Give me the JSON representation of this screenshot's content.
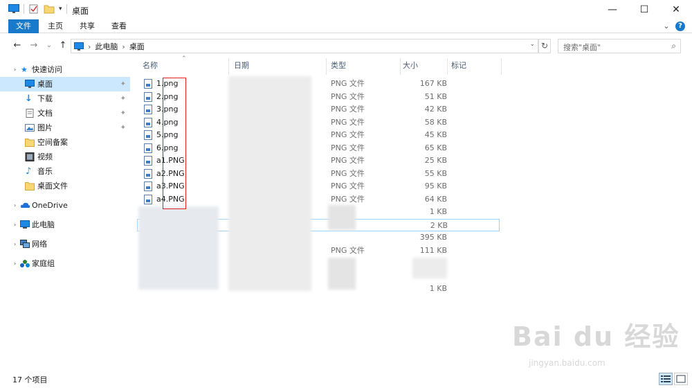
{
  "window": {
    "title": "桌面",
    "controls": {
      "minimize": "—",
      "maximize": "☐",
      "close": "✕"
    }
  },
  "ribbon": {
    "tabs": [
      "文件",
      "主页",
      "共享",
      "查看"
    ],
    "help": "?",
    "expand": "⌄"
  },
  "nav": {
    "back": "←",
    "forward": "→",
    "recent": "⌄",
    "up": "↑",
    "breadcrumb": [
      "此电脑",
      "桌面"
    ],
    "search_placeholder": "搜索\"桌面\""
  },
  "sidebar": {
    "items": [
      {
        "label": "快速访问",
        "icon": "star-icon",
        "pinned": false
      },
      {
        "label": "桌面",
        "icon": "desktop-icon",
        "pinned": true,
        "selected": true
      },
      {
        "label": "下载",
        "icon": "download-icon",
        "pinned": true
      },
      {
        "label": "文档",
        "icon": "document-icon",
        "pinned": true
      },
      {
        "label": "图片",
        "icon": "picture-icon",
        "pinned": true
      },
      {
        "label": "空间备案",
        "icon": "folder-icon",
        "pinned": false
      },
      {
        "label": "视频",
        "icon": "video-icon",
        "pinned": false
      },
      {
        "label": "音乐",
        "icon": "music-icon",
        "pinned": false
      },
      {
        "label": "桌面文件",
        "icon": "folder-icon",
        "pinned": false
      },
      {
        "label": "OneDrive",
        "icon": "cloud-icon",
        "pinned": false
      },
      {
        "label": "此电脑",
        "icon": "computer-icon",
        "pinned": false
      },
      {
        "label": "网络",
        "icon": "network-icon",
        "pinned": false
      },
      {
        "label": "家庭组",
        "icon": "homegroup-icon",
        "pinned": false
      }
    ],
    "pin_glyph": "📌"
  },
  "columns": {
    "name": "名称",
    "date": "日期",
    "type": "类型",
    "size": "大小",
    "tags": "标记"
  },
  "files": [
    {
      "name": "1.png",
      "type": "PNG 文件",
      "size": "167 KB"
    },
    {
      "name": "2.png",
      "type": "PNG 文件",
      "size": "51 KB"
    },
    {
      "name": "3.png",
      "type": "PNG 文件",
      "size": "42 KB"
    },
    {
      "name": "4.png",
      "type": "PNG 文件",
      "size": "58 KB"
    },
    {
      "name": "5.png",
      "type": "PNG 文件",
      "size": "45 KB"
    },
    {
      "name": "6.png",
      "type": "PNG 文件",
      "size": "65 KB"
    },
    {
      "name": "a1.PNG",
      "type": "PNG 文件",
      "size": "25 KB"
    },
    {
      "name": "a2.PNG",
      "type": "PNG 文件",
      "size": "55 KB"
    },
    {
      "name": "a3.PNG",
      "type": "PNG 文件",
      "size": "95 KB"
    },
    {
      "name": "a4.PNG",
      "type": "PNG 文件",
      "size": "64 KB"
    }
  ],
  "obscured_rows": [
    {
      "type": "",
      "size": "1 KB"
    },
    {
      "type": "",
      "size": "2 KB"
    },
    {
      "type": "",
      "size": "395 KB"
    },
    {
      "type": "PNG 文件",
      "size": "111 KB"
    },
    {
      "type": "",
      "size": ""
    },
    {
      "type": "",
      "size": "1 KB"
    }
  ],
  "status": {
    "count": "17 个项目"
  },
  "watermark": {
    "brand": "Bai du 经验",
    "url": "jingyan.baidu.com"
  },
  "colors": {
    "accent": "#1979ca",
    "selection": "#cce8ff",
    "highlight_box": "#e02020"
  }
}
